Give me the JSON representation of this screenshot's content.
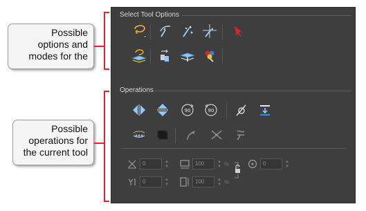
{
  "callouts": {
    "tool_options": {
      "lines": [
        "Possible",
        "options and",
        "modes for the"
      ]
    },
    "operations": {
      "lines": [
        "Possible",
        "operations for",
        "the current tool"
      ]
    }
  },
  "panel": {
    "select_tool_options": {
      "title": "Select Tool Options",
      "row1_icons": [
        "lasso-select-icon",
        "transform-icon",
        "select-by-color-icon",
        "select-by-center-icon",
        "red-cursor-icon"
      ],
      "row2_icons": [
        "lasso-working-layer-icon",
        "apply-to-all-drawings-icon",
        "snap-to-layer-icon",
        "color-swap-icon"
      ]
    },
    "operations": {
      "title": "Operations",
      "row1_icons": [
        "flip-horizontal-icon",
        "flip-vertical-icon",
        "rotate-90-cw-icon",
        "rotate-90-ccw-icon",
        "smooth-icon",
        "merge-icon"
      ],
      "row2_icons": [
        "flatten-icon",
        "create-color-art-icon",
        "distort-icon",
        "cut-icon",
        "reduce-points-icon"
      ],
      "fields": {
        "x_value": "0",
        "y_value": "0",
        "width_value": "100",
        "height_value": "100",
        "width_unit": "%",
        "height_unit": "%",
        "angle_value": "0"
      }
    }
  },
  "colors": {
    "accent_red": "#e2232a",
    "panel_bg": "#3e3e3e"
  }
}
